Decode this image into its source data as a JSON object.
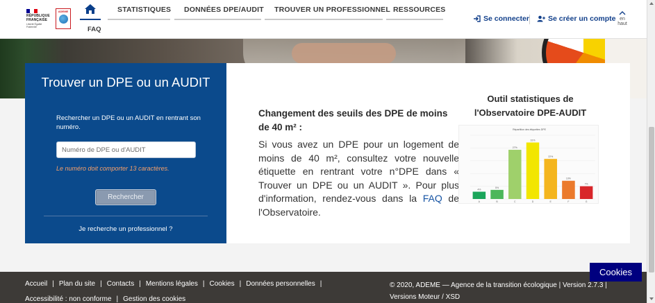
{
  "header": {
    "logo_rf": {
      "line1": "RÉPUBLIQUE",
      "line2": "FRANÇAISE",
      "motto": "Liberté Égalité Fraternité"
    },
    "logo_ademe": "ADEME",
    "nav": [
      {
        "label": "STATISTIQUES"
      },
      {
        "label": "DONNÉES DPE/AUDIT"
      },
      {
        "label": "TROUVER UN PROFESSIONNEL"
      },
      {
        "label": "RESSOURCES"
      }
    ],
    "faq": "FAQ",
    "login": "Se connecter",
    "signup": "Se créer un compte",
    "to_top_line1": "en",
    "to_top_line2": "haut"
  },
  "search_panel": {
    "title": "Trouver un DPE ou un AUDIT",
    "description": "Rechercher un DPE ou un AUDIT en rentrant son numéro.",
    "input_placeholder": "Numéro de DPE ou d'AUDIT",
    "hint": "Le numéro doit comporter 13 caractères.",
    "button": "Rechercher",
    "pro_link": "Je recherche un professionnel ?"
  },
  "announcement": {
    "title": "Changement des seuils des DPE de moins de 40 m² :",
    "body_before": "Si vous avez un DPE pour un logement de moins de 40 m², consultez votre nouvelle étiquette en rentrant votre n°DPE dans « Trouver un DPE ou un AUDIT ». Pour plus d'information, rendez-vous dans la",
    "faq_link": "FAQ",
    "body_after": "de l'Observatoire."
  },
  "stats": {
    "title": "Outil statistiques de l'Observatoire DPE-AUDIT"
  },
  "chart_data": {
    "type": "bar",
    "title": "Répartition des étiquettes DPE",
    "categories": [
      "A",
      "B",
      "C",
      "D",
      "E",
      "F",
      "G"
    ],
    "values": [
      4,
      5,
      27,
      31,
      22,
      10,
      7
    ],
    "labels": [
      "4%",
      "5%",
      "27%",
      "31%",
      "22%",
      "10%",
      "7%"
    ],
    "colors": [
      "#1aa55a",
      "#4cb75b",
      "#9fd06b",
      "#f2e600",
      "#f4b51e",
      "#eb7a2c",
      "#d8262a"
    ],
    "ylim": [
      0,
      35
    ]
  },
  "footer": {
    "links": [
      "Accueil",
      "Plan du site",
      "Contacts",
      "Mentions légales",
      "Cookies",
      "Données personnelles",
      "Accessibilité : non conforme",
      "Gestion des cookies"
    ],
    "copyright": "© 2020, ADEME — Agence de la transition écologique  |  Version 2.7.3  |",
    "versions": "Versions Moteur / XSD",
    "cookies_button": "Cookies"
  }
}
